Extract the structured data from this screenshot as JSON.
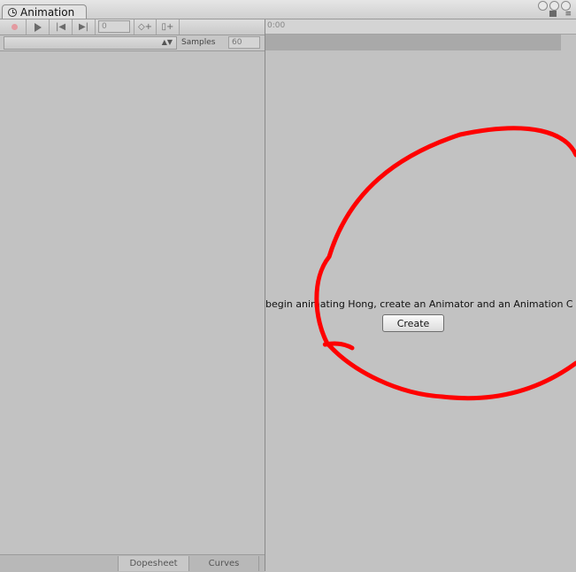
{
  "window": {
    "tab_label": "Animation",
    "tab_icon": "clock-icon"
  },
  "toolbar": {
    "frame_value": "0",
    "icons": [
      "record-icon",
      "play-icon",
      "prev-key-icon",
      "next-key-icon",
      "add-keyframe-icon",
      "add-event-icon"
    ]
  },
  "clip_panel": {
    "samples_label": "Samples",
    "samples_value": "60"
  },
  "bottom_tabs": [
    "Dopesheet",
    "Curves"
  ],
  "timeline": {
    "start_label": "0:00"
  },
  "empty_state": {
    "message": "begin animating Hong, create an Animator and an Animation C",
    "create_label": "Create"
  },
  "annotation": {
    "color": "#ff0000",
    "shape": "hand-drawn circle"
  }
}
